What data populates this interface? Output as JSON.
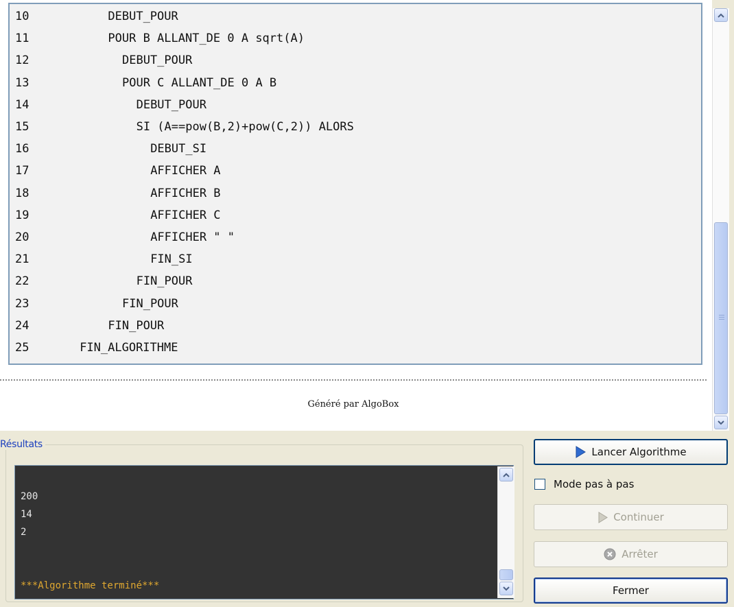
{
  "code_lines": [
    {
      "num": "10",
      "indent": 8,
      "text": "DEBUT_POUR"
    },
    {
      "num": "11",
      "indent": 8,
      "text": "POUR B ALLANT_DE 0 A sqrt(A)"
    },
    {
      "num": "12",
      "indent": 10,
      "text": "DEBUT_POUR"
    },
    {
      "num": "13",
      "indent": 10,
      "text": "POUR C ALLANT_DE 0 A B"
    },
    {
      "num": "14",
      "indent": 12,
      "text": "DEBUT_POUR"
    },
    {
      "num": "15",
      "indent": 12,
      "text": "SI (A==pow(B,2)+pow(C,2)) ALORS"
    },
    {
      "num": "16",
      "indent": 14,
      "text": "DEBUT_SI"
    },
    {
      "num": "17",
      "indent": 14,
      "text": "AFFICHER A"
    },
    {
      "num": "18",
      "indent": 14,
      "text": "AFFICHER B"
    },
    {
      "num": "19",
      "indent": 14,
      "text": "AFFICHER C"
    },
    {
      "num": "20",
      "indent": 14,
      "text": "AFFICHER \" \""
    },
    {
      "num": "21",
      "indent": 14,
      "text": "FIN_SI"
    },
    {
      "num": "22",
      "indent": 12,
      "text": "FIN_POUR"
    },
    {
      "num": "23",
      "indent": 10,
      "text": "FIN_POUR"
    },
    {
      "num": "24",
      "indent": 8,
      "text": "FIN_POUR"
    },
    {
      "num": "25",
      "indent": 4,
      "text": "FIN_ALGORITHME"
    }
  ],
  "footer": {
    "generated_by": "Généré par AlgoBox"
  },
  "results": {
    "label": "Résultats",
    "lines": [
      "200",
      "14",
      "2"
    ],
    "done": "***Algorithme terminé***"
  },
  "controls": {
    "run_label": "Lancer Algorithme",
    "step_mode_label": "Mode pas à pas",
    "step_mode_checked": false,
    "continue_label": "Continuer",
    "stop_label": "Arrêter",
    "close_label": "Fermer"
  },
  "icons": {
    "run": "play-icon",
    "continue": "play-icon",
    "stop": "stop-icon"
  },
  "colors": {
    "accent": "#1b3fbe",
    "console_bg": "#333333",
    "done_text": "#e0a830",
    "play_icon": "#2f6bd0"
  }
}
